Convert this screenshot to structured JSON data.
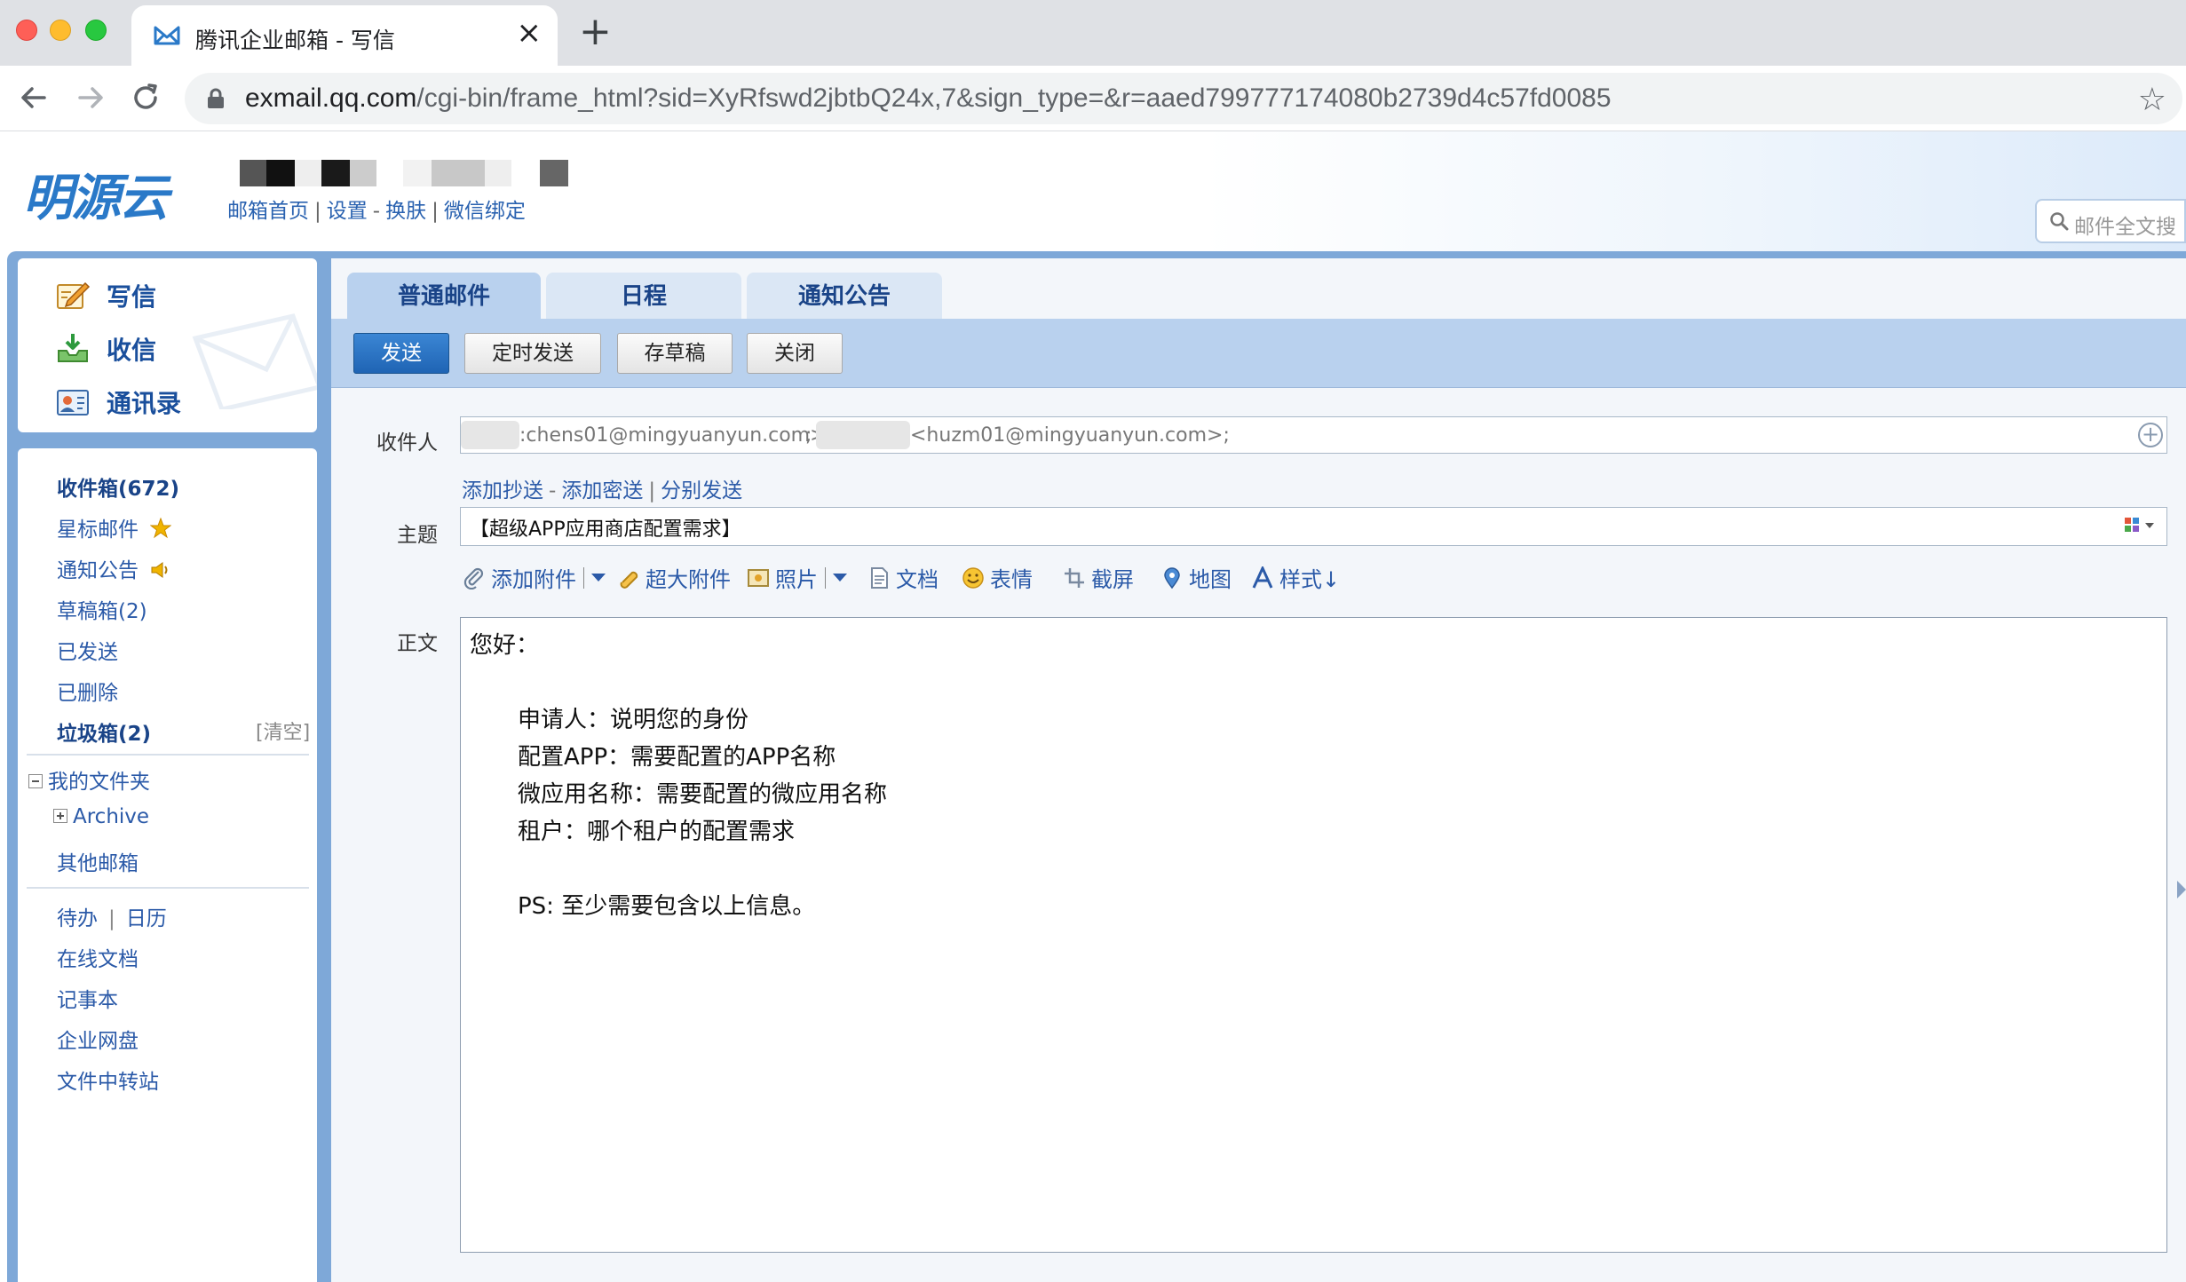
{
  "browser": {
    "tab_title": "腾讯企业邮箱 - 写信",
    "url_host": "exmail.qq.com",
    "url_path": "/cgi-bin/frame_html?sid=XyRfswd2jbtbQ24x,7&sign_type=&r=aaed799777174080b2739d4c57fd0085"
  },
  "header": {
    "logo": "明源云",
    "links": [
      "邮箱首页",
      "设置",
      "换肤",
      "微信绑定"
    ],
    "search_placeholder": "邮件全文搜"
  },
  "quick_actions": [
    {
      "label": "写信",
      "icon": "compose-icon"
    },
    {
      "label": "收信",
      "icon": "inbox-download-icon"
    },
    {
      "label": "通讯录",
      "icon": "contacts-icon"
    }
  ],
  "sidebar": {
    "inbox": "收件箱(672)",
    "starred": "星标邮件",
    "notices": "通知公告",
    "drafts": "草稿箱(2)",
    "sent": "已发送",
    "deleted": "已删除",
    "spam": "垃圾箱(2)",
    "spam_clear": "[清空]",
    "my_folders": "我的文件夹",
    "archive": "Archive",
    "other_mailbox": "其他邮箱",
    "todo": "待办",
    "calendar": "日历",
    "online_docs": "在线文档",
    "notes": "记事本",
    "netdisk": "企业网盘",
    "file_transfer": "文件中转站"
  },
  "compose": {
    "tabs": [
      "普通邮件",
      "日程",
      "通知公告"
    ],
    "actions": {
      "send": "发送",
      "schedule": "定时发送",
      "save_draft": "存草稿",
      "close": "关闭"
    },
    "labels": {
      "to": "收件人",
      "subject": "主题",
      "body": "正文"
    },
    "recipients": [
      ":chens01@mingyuanyun.com>",
      ";",
      "<huzm01@mingyuanyun.com>;"
    ],
    "recipient_links": [
      "添加抄送",
      "添加密送",
      "分别发送"
    ],
    "subject": "【超级APP应用商店配置需求】",
    "editor_tools": [
      "添加附件",
      "超大附件",
      "照片",
      "文档",
      "表情",
      "截屏",
      "地图",
      "样式↓"
    ],
    "body_lines": [
      "您好：",
      "申请人：说明您的身份",
      "配置APP：需要配置的APP名称",
      "微应用名称：需要配置的微应用名称",
      "租户：哪个租户的配置需求",
      "PS: 至少需要包含以上信息。"
    ]
  },
  "colors": {
    "brand_blue": "#2a79c8",
    "frame_blue": "#7ea8d8",
    "link_blue": "#2b5aa8",
    "send_button": "#1f64b4",
    "star_gold": "#f0b400"
  }
}
